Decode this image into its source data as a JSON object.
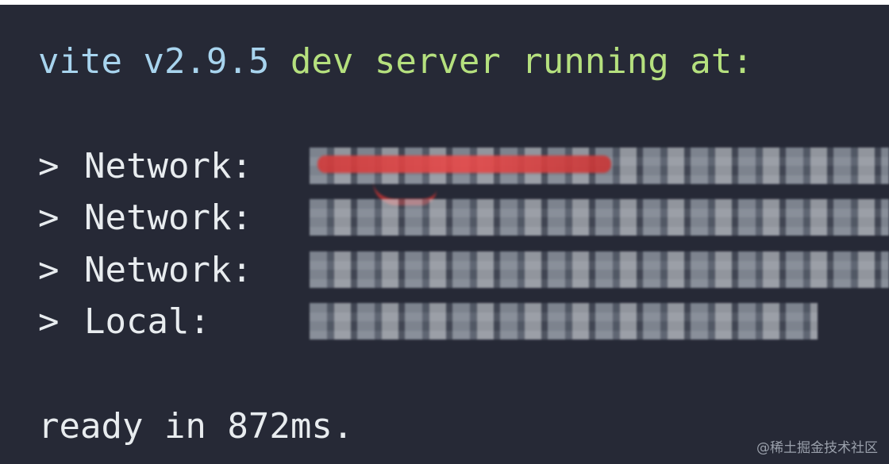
{
  "terminal": {
    "banner_vite": "vite v2.9.5",
    "banner_rest": " dev server running at:",
    "prompt": ">",
    "rows": [
      {
        "label": "Network:"
      },
      {
        "label": "Network:"
      },
      {
        "label": "Network:"
      },
      {
        "label": "Local:"
      }
    ],
    "ready": "ready in 872ms.",
    "watermark": "@稀土掘金技术社区"
  },
  "colors": {
    "background": "#262936",
    "vite_text": "#a8d4ee",
    "dev_text": "#b5e07e",
    "default_text": "#e8ecef"
  }
}
